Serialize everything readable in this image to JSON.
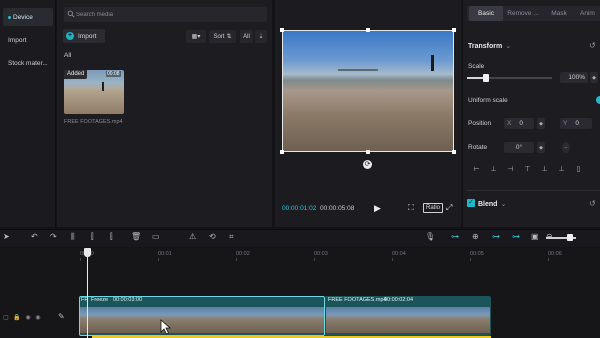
{
  "nav": {
    "items": [
      {
        "label": "Device",
        "active": true
      },
      {
        "label": "Import",
        "active": false
      },
      {
        "label": "Stock mater...",
        "active": false
      }
    ]
  },
  "media": {
    "search_placeholder": "Search media",
    "import_label": "Import",
    "sort_label": "Sort",
    "all_filter_label": "All",
    "section_label": "All",
    "clip": {
      "badge": "Added",
      "duration": "00:08",
      "name": "FREE FOOTAGES.mp4"
    }
  },
  "player": {
    "current_time": "00:00:01:02",
    "total_time": "00:00:05:08",
    "ratio_label": "Ratio"
  },
  "inspector": {
    "tabs": [
      "Basic",
      "Remove ...",
      "Mask",
      "Anim"
    ],
    "active_tab": "Basic",
    "transform_label": "Transform",
    "scale_label": "Scale",
    "scale_value": "100%",
    "scale_level": 0.22,
    "uniform_scale_label": "Uniform scale",
    "position_label": "Position",
    "position_x_label": "X",
    "position_x_value": "0",
    "position_y_label": "Y",
    "position_y_value": "0",
    "rotate_label": "Rotate",
    "rotate_value": "0°",
    "blend_label": "Blend"
  },
  "timeline": {
    "ruler": [
      "00:00",
      "00:01",
      "00:02",
      "00:03",
      "00:04",
      "00:05",
      "00:06"
    ],
    "clip1": {
      "prefix": "FR",
      "label": "Freeze",
      "duration": "00:00:03:00"
    },
    "clip2": {
      "name": "FREE FOOTAGES.mp4",
      "duration": "00:00:02:04"
    },
    "zoom_level": 0.7
  },
  "colors": {
    "accent": "#2ec6d8",
    "freeze": "#f0c419"
  }
}
